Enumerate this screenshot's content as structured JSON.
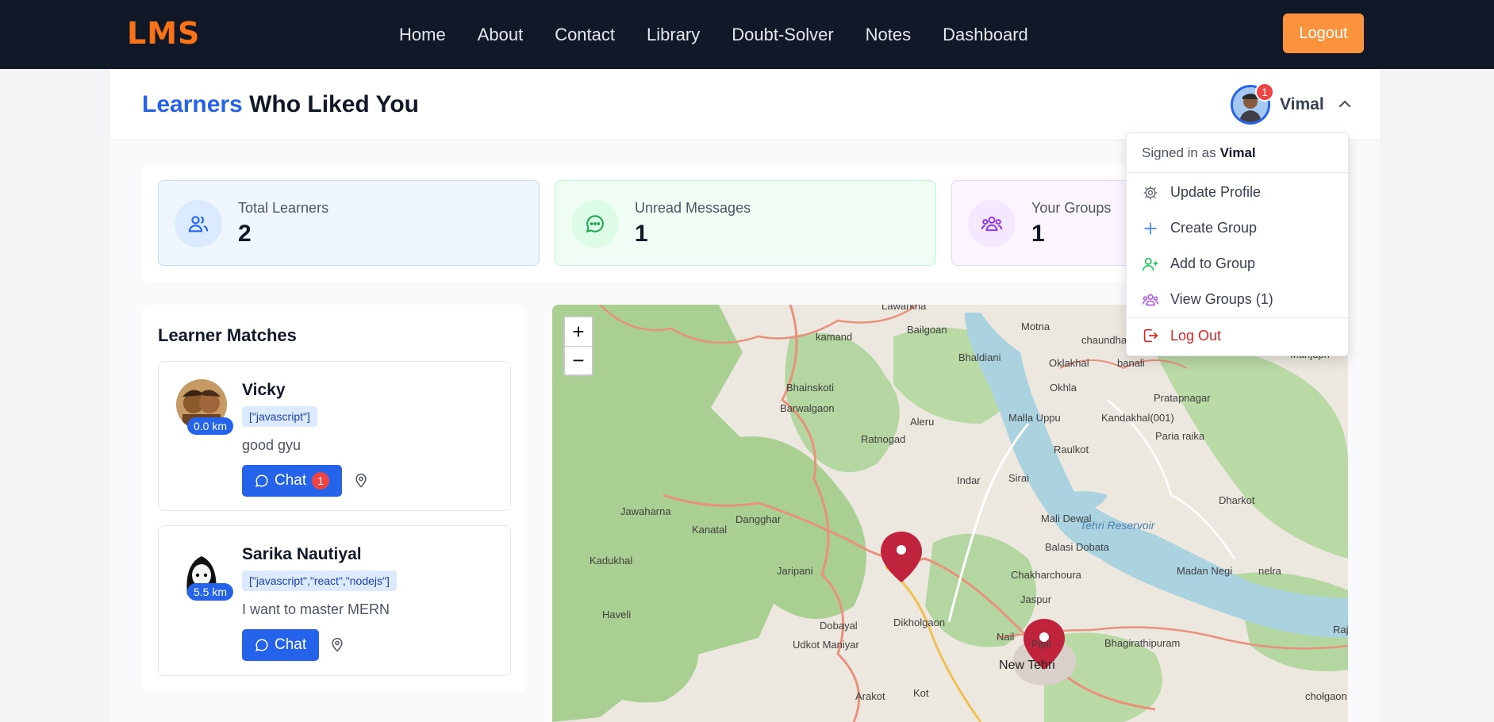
{
  "navbar": {
    "brand": "LMS",
    "links": [
      "Home",
      "About",
      "Contact",
      "Library",
      "Doubt-Solver",
      "Notes",
      "Dashboard"
    ],
    "logout_label": "Logout"
  },
  "header": {
    "title_accent": "Learners",
    "title_rest": " Who Liked You",
    "user": {
      "name": "Vimal",
      "notification_count": "1"
    }
  },
  "stats": [
    {
      "label": "Total Learners",
      "value": "2",
      "icon": "users-icon"
    },
    {
      "label": "Unread Messages",
      "value": "1",
      "icon": "message-icon"
    },
    {
      "label": "Your Groups",
      "value": "1",
      "icon": "groups-icon"
    }
  ],
  "matches": {
    "title": "Learner Matches",
    "items": [
      {
        "name": "Vicky",
        "distance": "0.0 km",
        "tags": "[\"javascript\"]",
        "bio": "good gyu",
        "chat_label": "Chat",
        "unread": "1"
      },
      {
        "name": "Sarika Nautiyal",
        "distance": "5.5 km",
        "tags": "[\"javascript\",\"react\",\"nodejs\"]",
        "bio": "I want to master MERN",
        "chat_label": "Chat"
      }
    ]
  },
  "map": {
    "zoom_in": "+",
    "zoom_out": "−",
    "places": [
      "Lawarkha",
      "kamand",
      "Bailgoan",
      "Motna",
      "chaundhaur",
      "Bhaldiani",
      "Oklakhal",
      "banali",
      "Bhainskoti",
      "Okhla",
      "Pratapnagar",
      "Barwalgaon",
      "Aleru",
      "Malla Uppu",
      "Kandakhal(001)",
      "Ratnogad",
      "Paria raika",
      "Raulkot",
      "Indar",
      "Sirai",
      "Dharkot",
      "Jawaharna",
      "Kanatal",
      "Dangghar",
      "Mali Dewal",
      "Tehri Reservoir",
      "Kadukhal",
      "Balasi Dobata",
      "Jaripani",
      "Chakharchoura",
      "Madan Negi",
      "nelra",
      "Jaspur",
      "Haveli",
      "Dobayal",
      "Dikholgaon",
      "Nail",
      "Pipli",
      "Bhagirathipuram",
      "Raj",
      "Udkot Maniyar",
      "New Tehri",
      "Arakot",
      "Kot",
      "chołgaon",
      "Manjupn"
    ]
  },
  "dropdown": {
    "signed_in_prefix": "Signed in as",
    "signed_in_user": "Vimal",
    "items": [
      {
        "label": "Update Profile",
        "icon": "gear-icon"
      },
      {
        "label": "Create Group",
        "icon": "plus-icon"
      },
      {
        "label": "Add to Group",
        "icon": "user-plus-icon"
      },
      {
        "label": "View Groups (1)",
        "icon": "groups-icon"
      },
      {
        "label": "Log Out",
        "icon": "logout-icon"
      }
    ]
  },
  "colors": {
    "brand": "#f97316",
    "primary": "#2563eb",
    "nav_bg": "#111827",
    "danger": "#dc2626"
  }
}
